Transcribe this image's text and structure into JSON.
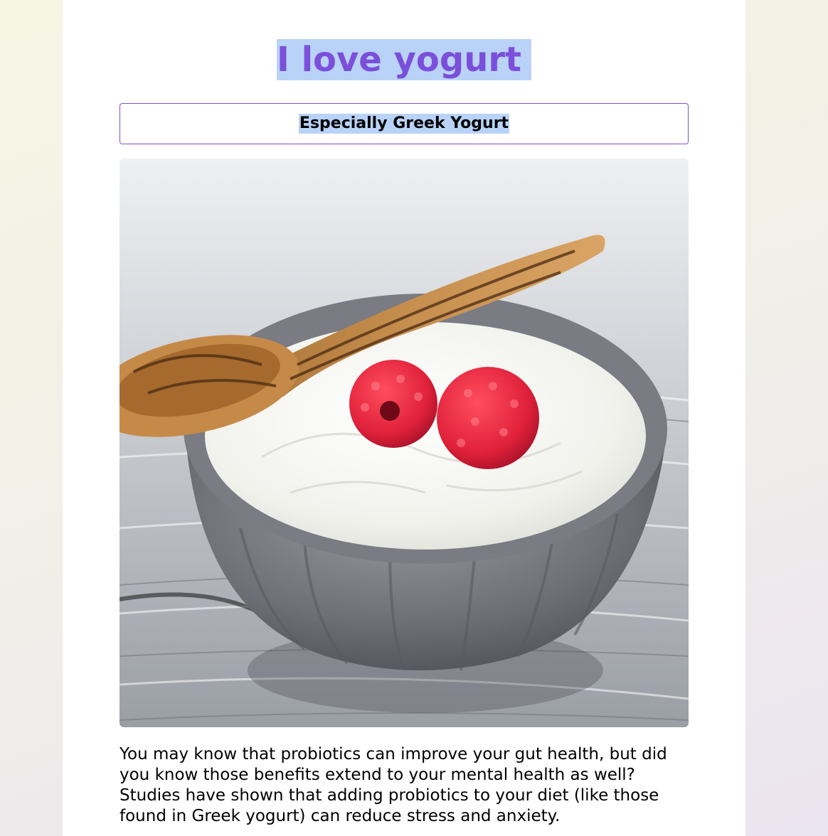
{
  "page": {
    "title": "I love yogurt",
    "subtitle": "Especially Greek Yogurt",
    "image": {
      "subject": "yogurt-bowl-with-raspberries-and-wooden-spoon"
    },
    "paragraph": "You may know that probiotics can improve your gut health, but did you know those benefits extend to your mental health as well? Studies have shown that adding probiotics to your diet (like those found in Greek yogurt) can reduce stress and anxiety."
  },
  "colors": {
    "accent": "#7b4fdb",
    "selection_highlight": "#b9d3f8",
    "card_background": "#ffffff"
  }
}
